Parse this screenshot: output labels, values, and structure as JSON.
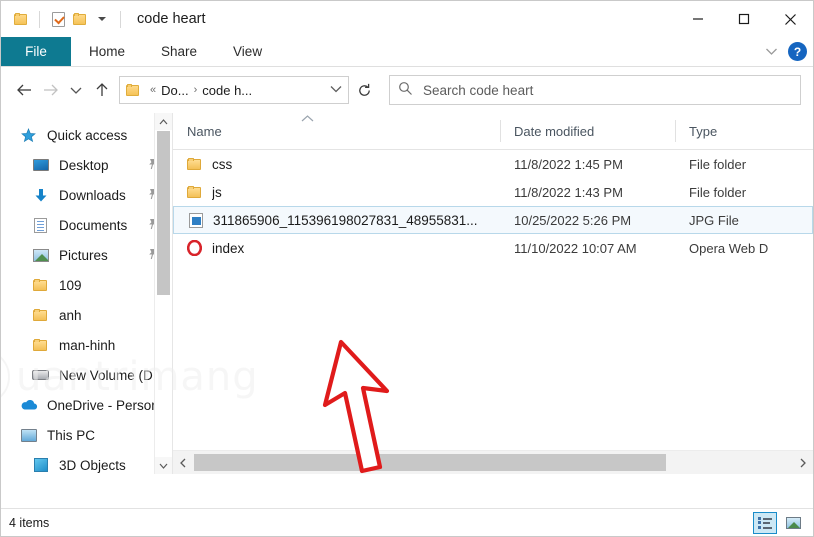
{
  "window": {
    "title": "code heart",
    "quick_access_toolbar": [
      {
        "name": "folder-icon",
        "label": "Folder"
      },
      {
        "name": "properties-icon",
        "label": "Properties"
      },
      {
        "name": "new-folder-icon",
        "label": "New folder"
      },
      {
        "name": "customize-dropdown-icon",
        "label": "Customize Quick Access Toolbar"
      }
    ],
    "controls": {
      "minimize": "Minimize",
      "maximize": "Maximize",
      "close": "Close"
    }
  },
  "ribbon": {
    "tabs": [
      {
        "label": "File",
        "active": true
      },
      {
        "label": "Home",
        "active": false
      },
      {
        "label": "Share",
        "active": false
      },
      {
        "label": "View",
        "active": false
      }
    ],
    "collapse_label": "Minimize the Ribbon",
    "help_label": "?"
  },
  "navbar": {
    "back": "Back",
    "forward": "Forward",
    "recent": "Recent locations",
    "up": "Up",
    "address": {
      "overflow": "«",
      "crumbs": [
        "Do...",
        "code h..."
      ],
      "separator": "›",
      "dropdown": "Previous locations"
    },
    "refresh": "Refresh"
  },
  "search": {
    "placeholder": "Search code heart",
    "icon": "search-icon"
  },
  "sidebar": {
    "items": [
      {
        "label": "Quick access",
        "icon": "star-icon",
        "pinned": false,
        "indent": false
      },
      {
        "label": "Desktop",
        "icon": "desktop-icon",
        "pinned": true,
        "indent": true
      },
      {
        "label": "Downloads",
        "icon": "download-icon",
        "pinned": true,
        "indent": true
      },
      {
        "label": "Documents",
        "icon": "documents-icon",
        "pinned": true,
        "indent": true
      },
      {
        "label": "Pictures",
        "icon": "pictures-icon",
        "pinned": true,
        "indent": true
      },
      {
        "label": "109",
        "icon": "folder-icon",
        "pinned": false,
        "indent": true
      },
      {
        "label": "anh",
        "icon": "folder-icon",
        "pinned": false,
        "indent": true
      },
      {
        "label": "man-hinh",
        "icon": "folder-icon",
        "pinned": false,
        "indent": true
      },
      {
        "label": "New Volume (D:)",
        "icon": "drive-icon",
        "pinned": false,
        "indent": true
      },
      {
        "label": "OneDrive - Person",
        "icon": "onedrive-icon",
        "pinned": false,
        "indent": false
      },
      {
        "label": "This PC",
        "icon": "this-pc-icon",
        "pinned": false,
        "indent": false
      },
      {
        "label": "3D Objects",
        "icon": "3d-objects-icon",
        "pinned": false,
        "indent": true
      }
    ]
  },
  "filelist": {
    "columns": [
      "Name",
      "Date modified",
      "Type"
    ],
    "sort_indicator": "ascending",
    "rows": [
      {
        "name": "css",
        "date": "11/8/2022 1:45 PM",
        "type": "File folder",
        "icon": "folder-icon",
        "selected": false
      },
      {
        "name": "js",
        "date": "11/8/2022 1:43 PM",
        "type": "File folder",
        "icon": "folder-icon",
        "selected": false
      },
      {
        "name": "311865906_115396198027831_48955831...",
        "date": "10/25/2022 5:26 PM",
        "type": "JPG File",
        "icon": "jpg-file-icon",
        "selected": true
      },
      {
        "name": "index",
        "date": "11/10/2022 10:07 AM",
        "type": "Opera Web D",
        "icon": "opera-icon",
        "selected": false
      }
    ]
  },
  "annotation": {
    "arrow_color": "#e01b1b",
    "arrow_target": "311865906_115396198027831_48955831..."
  },
  "watermark": {
    "text": "uantrimang",
    "color": "#efefef"
  },
  "status": {
    "item_count": "4 items",
    "views": [
      {
        "name": "details-view-button",
        "active": true
      },
      {
        "name": "large-icons-view-button",
        "active": false
      }
    ]
  },
  "colors": {
    "file_tab": "#0e7a91",
    "selection": "#f4f9fd",
    "selection_border": "#b8d8ea",
    "help_blue": "#1565c0"
  }
}
